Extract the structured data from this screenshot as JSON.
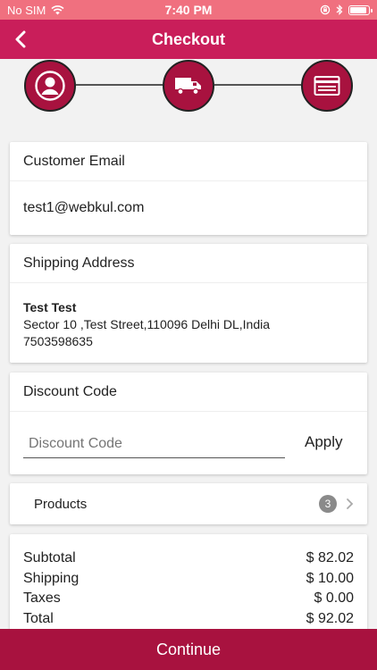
{
  "status_bar": {
    "carrier": "No SIM",
    "time": "7:40 PM"
  },
  "nav": {
    "title": "Checkout",
    "back_icon": "chevron-left-icon"
  },
  "stepper": {
    "steps": [
      {
        "icon": "user-icon"
      },
      {
        "icon": "truck-icon"
      },
      {
        "icon": "payment-card-icon"
      }
    ]
  },
  "customer_email": {
    "heading": "Customer Email",
    "value": "test1@webkul.com"
  },
  "shipping_address": {
    "heading": "Shipping Address",
    "name": "Test Test",
    "line": "Sector 10 ,Test Street,110096 Delhi DL,India",
    "phone": "7503598635"
  },
  "discount": {
    "heading": "Discount Code",
    "placeholder": "Discount Code",
    "apply_label": "Apply"
  },
  "products": {
    "label": "Products",
    "count": "3"
  },
  "totals": {
    "rows": [
      {
        "label": "Subtotal",
        "value": "$ 82.02"
      },
      {
        "label": "Shipping",
        "value": "$ 10.00"
      },
      {
        "label": "Taxes",
        "value": "$ 0.00"
      },
      {
        "label": "Total",
        "value": "$ 92.02"
      }
    ]
  },
  "continue_label": "Continue",
  "colors": {
    "status": "#f0707f",
    "nav": "#c91e5a",
    "accent": "#a8123f"
  }
}
